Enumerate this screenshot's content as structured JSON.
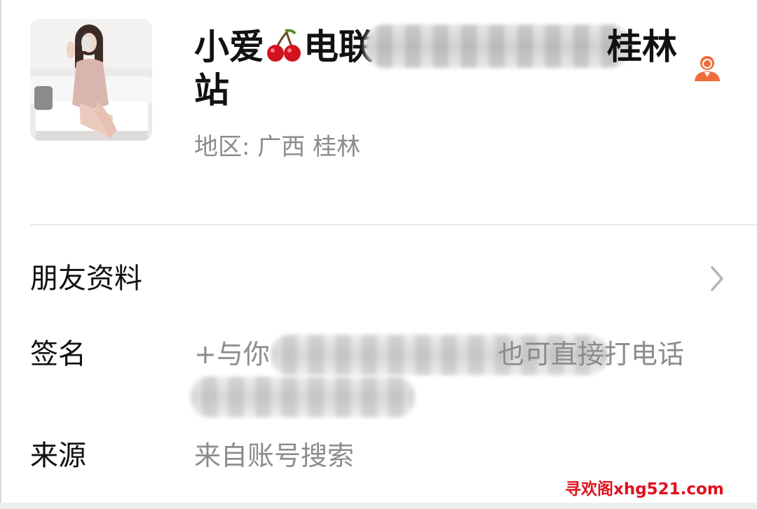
{
  "profile": {
    "name_prefix": "小爱",
    "name_mid": "电联",
    "name_suffix": "桂林",
    "name_line2": "站",
    "region": "地区:  广西  桂林",
    "avatar_icon": "profile-photo",
    "verified_icon": "person-icon"
  },
  "rows": {
    "friend_info_label": "朋友资料",
    "signature_label": "签名",
    "signature_prefix": "+与你",
    "signature_tail": "也可直接打电话",
    "source_label": "来源",
    "source_value": "来自账号搜索"
  },
  "watermark": "寻欢阁xhg521.com",
  "colors": {
    "text_primary": "#111111",
    "text_secondary": "#8c8c8c",
    "accent_icon": "#f26b3a",
    "watermark": "#e0111e"
  }
}
